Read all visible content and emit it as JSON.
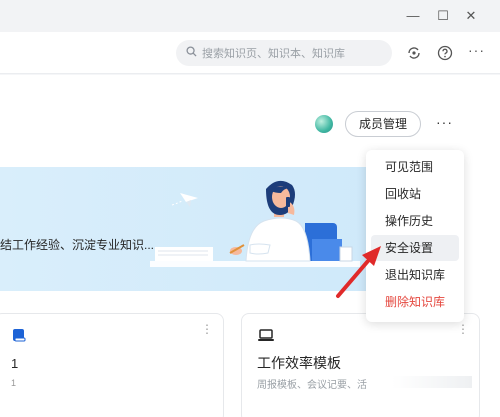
{
  "window": {
    "minimize_glyph": "—",
    "maximize_glyph": "☐",
    "close_glyph": "✕"
  },
  "header": {
    "search_placeholder": "搜索知识页、知识本、知识库",
    "icons": [
      "search-icon",
      "sync-icon",
      "help-icon",
      "more-icon"
    ]
  },
  "toolbar": {
    "member_button_label": "成员管理",
    "more_label": "···"
  },
  "banner": {
    "text": "结工作经验、沉淀专业知识..."
  },
  "cards": [
    {
      "icon": "book-icon",
      "title": "1",
      "subtitle": "1",
      "menu": "⋮"
    },
    {
      "icon": "laptop-icon",
      "title": "工作效率模板",
      "subtitle": "周报模板、会议记要、活",
      "menu": "⋮"
    }
  ],
  "dropdown": {
    "items": [
      {
        "label": "可见范围"
      },
      {
        "label": "回收站"
      },
      {
        "label": "操作历史"
      },
      {
        "label": "安全设置"
      },
      {
        "label": "退出知识库"
      },
      {
        "label": "删除知识库"
      }
    ]
  },
  "colors": {
    "accent_blue": "#1d63d6",
    "danger": "#e5483f",
    "banner_bg": "#d4ebfa",
    "arrow": "#e02a2a"
  }
}
